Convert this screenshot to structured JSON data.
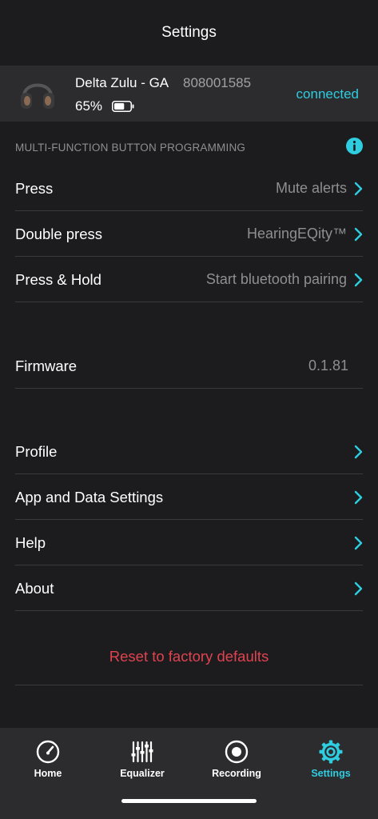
{
  "header": {
    "title": "Settings"
  },
  "device": {
    "name": "Delta Zulu - GA",
    "serial": "808001585",
    "battery": "65%",
    "battery_level": 0.65,
    "status": "connected"
  },
  "mfb": {
    "section_title": "MULTI-FUNCTION BUTTON PROGRAMMING",
    "rows": [
      {
        "label": "Press",
        "value": "Mute alerts"
      },
      {
        "label": "Double press",
        "value": "HearingEQity™"
      },
      {
        "label": "Press & Hold",
        "value": "Start bluetooth pairing"
      }
    ]
  },
  "firmware": {
    "label": "Firmware",
    "value": "0.1.81"
  },
  "menu": [
    {
      "label": "Profile"
    },
    {
      "label": "App and Data Settings"
    },
    {
      "label": "Help"
    },
    {
      "label": "About"
    }
  ],
  "reset": {
    "label": "Reset to factory defaults"
  },
  "tabs": [
    {
      "label": "Home",
      "icon": "speedometer-icon"
    },
    {
      "label": "Equalizer",
      "icon": "equalizer-icon"
    },
    {
      "label": "Recording",
      "icon": "record-icon"
    },
    {
      "label": "Settings",
      "icon": "gear-icon",
      "active": true
    }
  ],
  "colors": {
    "accent": "#2ecde0",
    "danger": "#e0434f",
    "background": "#1c1c1e",
    "panel": "#2c2c2e"
  }
}
